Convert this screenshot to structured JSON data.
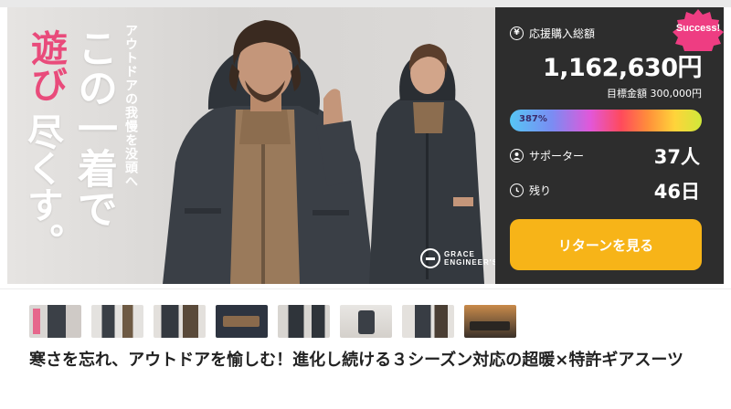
{
  "hero": {
    "catch_pink": "遊び",
    "catch_white_1": "尽くす。",
    "catch_white_2": "この一着で",
    "catch_sub": "アウトドアの我慢を没頭へ",
    "brand_logo_line1": "GRACE",
    "brand_logo_line2": "ENGINEER'S"
  },
  "panel": {
    "badge": "Success!",
    "total_label": "応援購入総額",
    "total_amount": "1,162,630円",
    "goal_text": "目標金額 300,000円",
    "progress_label": "387%",
    "progress_percent": 387,
    "supporters_label": "サポーター",
    "supporters_value": "37人",
    "remaining_label": "残り",
    "remaining_value": "46日",
    "return_button": "リターンを見る"
  },
  "thumbnails": [
    {
      "name": "thumb-1"
    },
    {
      "name": "thumb-2"
    },
    {
      "name": "thumb-3"
    },
    {
      "name": "thumb-4"
    },
    {
      "name": "thumb-5"
    },
    {
      "name": "thumb-6"
    },
    {
      "name": "thumb-7"
    },
    {
      "name": "thumb-8"
    }
  ],
  "title": "寒さを忘れ、アウトドアを愉しむ！進化し続ける３シーズン対応の超暖×特許ギアスーツ",
  "colors": {
    "accent_pink": "#e94b7b",
    "panel_bg": "#2d2d2d",
    "button_yellow": "#f7b418",
    "badge_pink": "#ee3d82"
  },
  "icons": {
    "total": "yen-circle-icon",
    "supporters": "user-circle-icon",
    "remaining": "clock-icon"
  }
}
